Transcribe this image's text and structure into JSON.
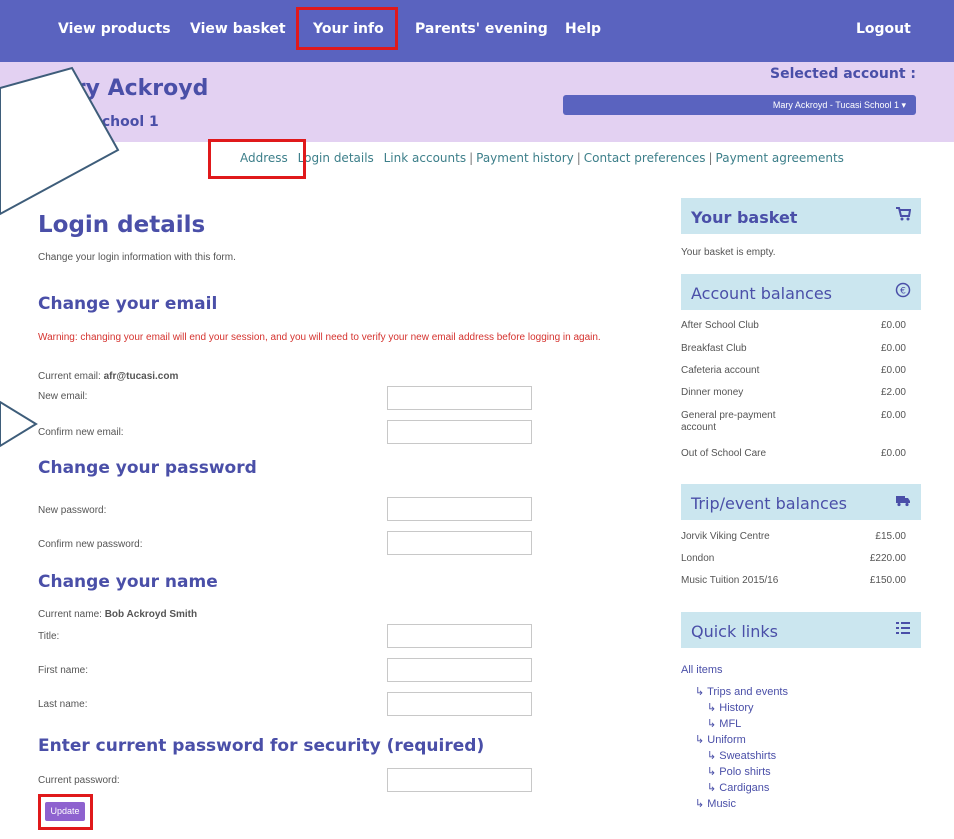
{
  "nav": {
    "items": [
      "View products",
      "View basket",
      "Your info",
      "Parents' evening",
      "Help"
    ],
    "logout": "Logout"
  },
  "header": {
    "user_name": "Mary Ackroyd",
    "school": "Tucasi School 1",
    "selected_account_label": "Selected account :",
    "selected_account_value": "Mary Ackroyd - Tucasi School 1 ▾"
  },
  "subnav": {
    "items": [
      "Address",
      "Login details",
      "Link accounts",
      "Payment history",
      "Contact preferences",
      "Payment agreements"
    ]
  },
  "main": {
    "title": "Login details",
    "intro": "Change your login information with this form.",
    "email_section": {
      "title": "Change your email",
      "warning": "Warning: changing your email will end your session, and you will need to verify your new email address before logging in again.",
      "current_label": "Current email:",
      "current_value": "afr@tucasi.com",
      "new_label": "New email:",
      "confirm_label": "Confirm new email:"
    },
    "password_section": {
      "title": "Change your password",
      "new_label": "New password:",
      "confirm_label": "Confirm new password:"
    },
    "name_section": {
      "title": "Change your name",
      "current_label": "Current name:",
      "current_value": "Bob Ackroyd Smith",
      "title_label": "Title:",
      "first_label": "First name:",
      "last_label": "Last name:"
    },
    "security_section": {
      "title": "Enter current password for security (required)",
      "current_label": "Current password:"
    },
    "update_button": "Update"
  },
  "sidebar": {
    "basket": {
      "title": "Your basket",
      "empty_text": "Your basket is empty.",
      "icon": "cart-icon"
    },
    "account_balances": {
      "title": "Account balances",
      "icon": "currency-icon",
      "rows": [
        {
          "name": "After School Club",
          "value": "£0.00"
        },
        {
          "name": "Breakfast Club",
          "value": "£0.00"
        },
        {
          "name": "Cafeteria account",
          "value": "£0.00"
        },
        {
          "name": "Dinner money",
          "value": "£2.00"
        },
        {
          "name": "General pre-payment account",
          "value": "£0.00"
        },
        {
          "name": "Out of School Care",
          "value": "£0.00"
        }
      ]
    },
    "trip_balances": {
      "title": "Trip/event balances",
      "icon": "truck-icon",
      "rows": [
        {
          "name": "Jorvik Viking Centre",
          "value": "£15.00"
        },
        {
          "name": "London",
          "value": "£220.00"
        },
        {
          "name": "Music Tuition 2015/16",
          "value": "£150.00"
        }
      ]
    },
    "quick_links": {
      "title": "Quick links",
      "icon": "list-icon",
      "all_items": "All items",
      "items": [
        "Trips and events",
        "History",
        "MFL",
        "Uniform",
        "Sweatshirts",
        "Polo shirts",
        "Cardigans",
        "Music"
      ]
    }
  },
  "colors": {
    "nav": "#5a63bf",
    "header": "#e3d1f2",
    "panel": "#cbe6ef",
    "highlight": "#e0191b",
    "title": "#4a4fa8",
    "warning": "#d5332f",
    "button": "#8e62cf"
  }
}
